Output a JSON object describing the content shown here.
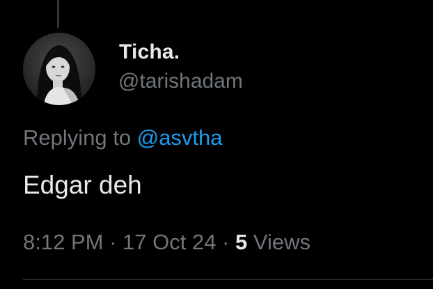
{
  "author": {
    "name": "Ticha.",
    "handle": "@tarishadam"
  },
  "reply": {
    "prefix": "Replying to ",
    "mention": "@asvtha"
  },
  "tweet": {
    "text": "Edgar deh"
  },
  "meta": {
    "time": "8:12 PM",
    "separator": " · ",
    "date": "17 Oct 24",
    "views_count": "5",
    "views_label": " Views"
  },
  "colors": {
    "background": "#000000",
    "primary_text": "#e7e9ea",
    "secondary_text": "#71767b",
    "link": "#1d9bf0"
  }
}
